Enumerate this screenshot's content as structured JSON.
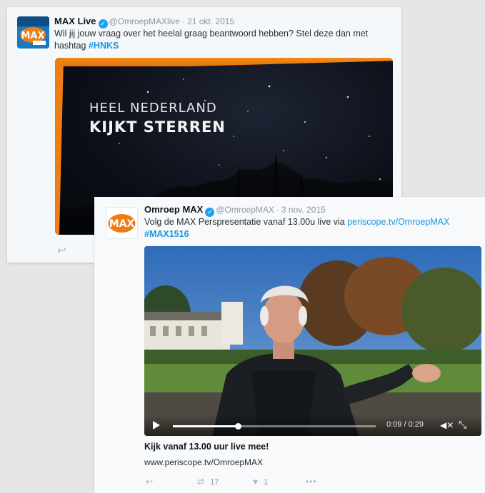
{
  "tweet1": {
    "name": "MAX Live",
    "handle": "@OmroepMAXlive",
    "date": "21 okt. 2015",
    "text_main": "Wil jij jouw vraag over het heelal graag beantwoord hebben? Stel deze dan met hashtag ",
    "hashtag": "#HNKS",
    "image_line1": "HEEL NEDERLAND",
    "image_line2": "KIJKT STERREN",
    "avatar_logo": "MAX"
  },
  "tweet2": {
    "name": "Omroep MAX",
    "handle": "@OmroepMAX",
    "date": "3 nov. 2015",
    "text_main": "Volg de MAX Perspresentatie vanaf 13.00u live via ",
    "link": "periscope.tv/OmroepMAX",
    "hashtag": "#MAX1516",
    "avatar_logo": "MAX",
    "video": {
      "time": "0:09 / 0:29",
      "progress": 0.32
    },
    "card_title": "Kijk vanaf 13.00 uur live mee!",
    "card_url": "www.periscope.tv/OmroepMAX",
    "retweets": "17",
    "likes": "1"
  },
  "colors": {
    "accent_blue": "#1b95e0",
    "max_orange": "#ef7d14"
  }
}
